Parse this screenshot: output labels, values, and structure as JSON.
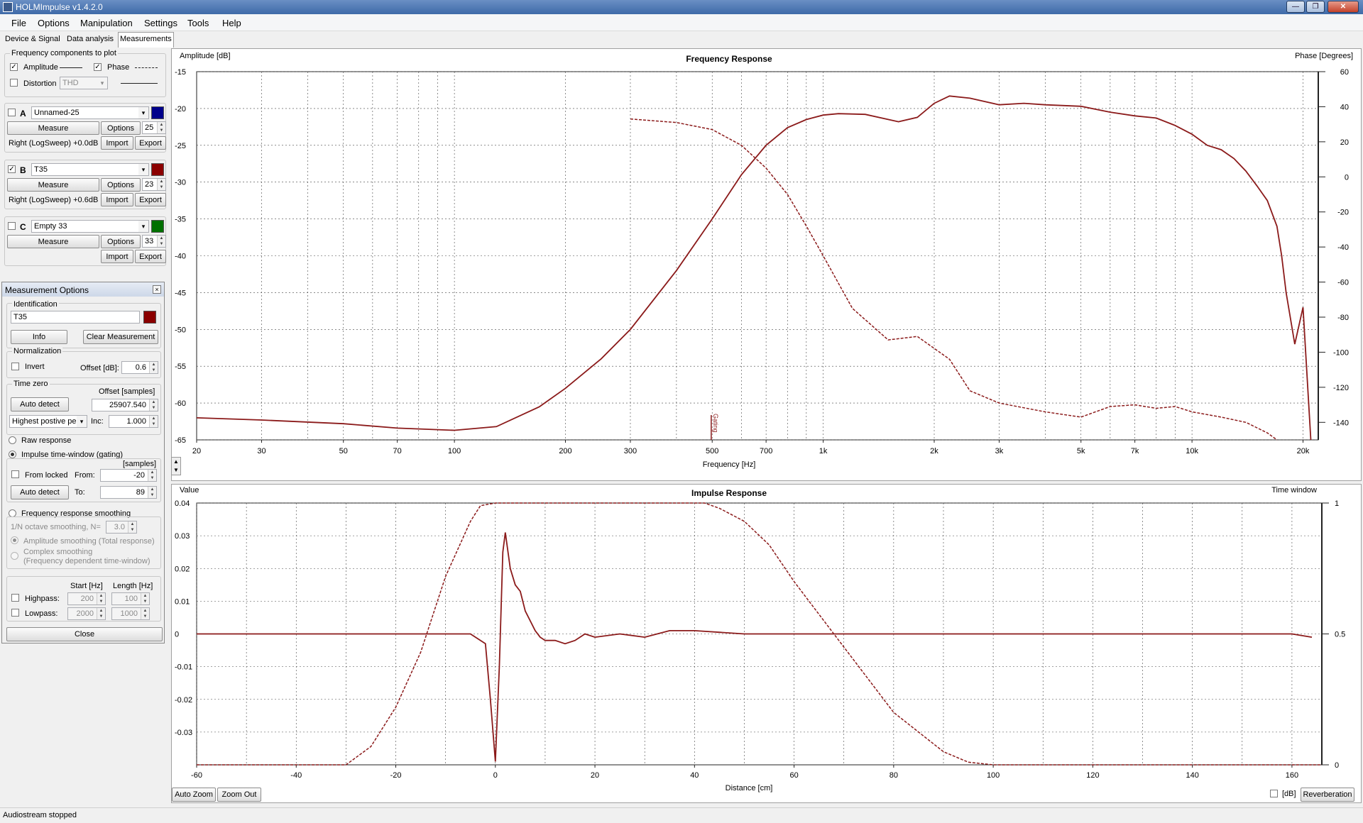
{
  "window": {
    "title": "HOLMImpulse  v1.4.2.0",
    "min": "—",
    "max": "❐",
    "close": "✕"
  },
  "menu": [
    "File",
    "Options",
    "Manipulation",
    "Settings",
    "Tools",
    "Help"
  ],
  "tabs": [
    "Device & Signal",
    "Data analysis",
    "Measurements"
  ],
  "freq_components": {
    "title": "Frequency components to plot",
    "amplitude": "Amplitude",
    "amplitude_checked": true,
    "phase": "Phase",
    "phase_checked": true,
    "distortion": "Distortion",
    "distortion_checked": false,
    "distortion_type": "THD"
  },
  "channels": [
    {
      "letter": "A",
      "checked": false,
      "name": "Unnamed-25",
      "color": "#00008b",
      "measure": "Measure",
      "options": "Options",
      "count": "25",
      "info": "Right (LogSweep) +0.0dB",
      "import": "Import",
      "export": "Export"
    },
    {
      "letter": "B",
      "checked": true,
      "name": "T35",
      "color": "#8b0000",
      "measure": "Measure",
      "options": "Options",
      "count": "23",
      "info": "Right (LogSweep) +0.6dB",
      "import": "Import",
      "export": "Export"
    },
    {
      "letter": "C",
      "checked": false,
      "name": "Empty 33",
      "color": "#007000",
      "measure": "Measure",
      "options": "Options",
      "count": "33",
      "info": "",
      "import": "Import",
      "export": "Export"
    }
  ],
  "meas_options": {
    "title": "Measurement Options",
    "identification": "Identification",
    "id_value": "T35",
    "id_color": "#8b0000",
    "info": "Info",
    "clear": "Clear Measurement",
    "normalization": "Normalization",
    "invert": "Invert",
    "offset_label": "Offset [dB]:",
    "offset_value": "0.6",
    "time_zero": "Time zero",
    "offset_samples_label": "Offset [samples]",
    "auto_detect": "Auto detect",
    "offset_samples": "25907.540",
    "peak_mode": "Highest postive pe",
    "inc_label": "Inc:",
    "inc_value": "1.000",
    "raw_response": "Raw response",
    "impulse_window": "Impulse time-window (gating)",
    "samples": "[samples]",
    "from_locked": "From locked",
    "from_label": "From:",
    "from_value": "-20",
    "to_label": "To:",
    "to_value": "89",
    "auto_detect2": "Auto detect",
    "fr_smoothing": "Frequency response smoothing",
    "octave": "1/N octave smoothing, N=",
    "octave_value": "3.0",
    "amp_smoothing": "Amplitude smoothing (Total response)",
    "complex_smoothing": "Complex smoothing",
    "complex_smoothing2": "(Frequency dependent time-window)",
    "start_hz": "Start [Hz]",
    "length_hz": "Length [Hz]",
    "highpass": "Highpass:",
    "hp_start": "200",
    "hp_length": "100",
    "lowpass": "Lowpass:",
    "lp_start": "2000",
    "lp_length": "1000",
    "close": "Close"
  },
  "freq_plot": {
    "title": "Frequency Response",
    "y_left_label": "Amplitude [dB]",
    "y_right_label": "Phase [Degrees]",
    "x_label": "Frequency [Hz]",
    "y_ticks": [
      "-15",
      "-20",
      "-25",
      "-30",
      "-35",
      "-40",
      "-45",
      "-50",
      "-55",
      "-60",
      "-65"
    ],
    "phase_ticks": [
      "60",
      "40",
      "20",
      "0",
      "-20",
      "-40",
      "-60",
      "-80",
      "-100",
      "-120",
      "-140"
    ],
    "x_ticks": [
      "20",
      "30",
      "50",
      "70",
      "100",
      "200",
      "300",
      "500",
      "700",
      "1k",
      "2k",
      "3k",
      "5k",
      "7k",
      "10k",
      "20k"
    ],
    "gating_marker": "Gating"
  },
  "impulse_plot": {
    "title": "Impulse Response",
    "y_left_label": "Value",
    "y_right_label": "Time window",
    "x_label": "Distance [cm]",
    "y_ticks": [
      "0.04",
      "0.03",
      "0.02",
      "0.01",
      "0",
      "-0.01",
      "-0.02",
      "-0.03"
    ],
    "window_ticks": [
      "1",
      "0.5",
      "0"
    ],
    "x_ticks": [
      "-60",
      "-40",
      "-20",
      "0",
      "20",
      "40",
      "60",
      "80",
      "100",
      "120",
      "140",
      "160"
    ]
  },
  "bottom_buttons": {
    "auto_zoom": "Auto Zoom",
    "zoom_out": "Zoom Out",
    "db": "[dB]",
    "reverberation": "Reverberation"
  },
  "status": "Audiostream stopped",
  "chart_data": [
    {
      "type": "line",
      "title": "Frequency Response",
      "xlabel": "Frequency [Hz]",
      "ylabel": "Amplitude [dB]",
      "y2label": "Phase [Degrees]",
      "xscale": "log",
      "xlim": [
        20,
        22000
      ],
      "ylim": [
        -65,
        -15
      ],
      "y2lim": [
        -150,
        60
      ],
      "grid": true,
      "series": [
        {
          "style": "solid",
          "axis": "left",
          "color": "#8b1a1a",
          "x": [
            20,
            30,
            50,
            70,
            100,
            130,
            170,
            200,
            250,
            300,
            400,
            500,
            600,
            700,
            800,
            900,
            1000,
            1100,
            1300,
            1600,
            1800,
            2000,
            2200,
            2500,
            3000,
            3500,
            4000,
            5000,
            6000,
            7000,
            8000,
            9000,
            10000,
            11000,
            12000,
            13000,
            14000,
            15000,
            16000,
            17000,
            17500,
            18000,
            19000,
            20000,
            21000
          ],
          "y": [
            -62,
            -62.3,
            -62.8,
            -63.4,
            -63.7,
            -63.2,
            -60.5,
            -58,
            -54,
            -50,
            -42,
            -35,
            -29,
            -25,
            -22.6,
            -21.5,
            -20.9,
            -20.7,
            -20.8,
            -21.8,
            -21.2,
            -19.3,
            -18.3,
            -18.6,
            -19.5,
            -19.3,
            -19.5,
            -19.7,
            -20.5,
            -21,
            -21.3,
            -22.3,
            -23.5,
            -25,
            -25.6,
            -26.8,
            -28.5,
            -30.5,
            -32.5,
            -36,
            -40,
            -45,
            -52,
            -47,
            -66
          ]
        },
        {
          "style": "dashed",
          "axis": "right",
          "color": "#8b1a1a",
          "x": [
            300,
            400,
            500,
            600,
            700,
            800,
            900,
            1000,
            1200,
            1500,
            1800,
            2200,
            2500,
            3000,
            4000,
            5000,
            6000,
            7000,
            8000,
            9000,
            10000,
            12000,
            14000,
            16000,
            17000
          ],
          "y": [
            33,
            31,
            27,
            18,
            5,
            -10,
            -28,
            -45,
            -75,
            -93,
            -91,
            -104,
            -122,
            -129,
            -134,
            -137,
            -131,
            -130,
            -132,
            -131,
            -134,
            -137,
            -140,
            -146,
            -152
          ]
        }
      ]
    },
    {
      "type": "line",
      "title": "Impulse Response",
      "xlabel": "Distance [cm]",
      "ylabel": "Value",
      "y2label": "Time window",
      "xlim": [
        -60,
        166
      ],
      "ylim": [
        -0.04,
        0.04
      ],
      "y2lim": [
        0,
        1
      ],
      "grid": true,
      "series": [
        {
          "style": "solid",
          "axis": "left",
          "color": "#8b1a1a",
          "x": [
            -60,
            -5,
            -2,
            -1,
            0,
            0.8,
            1.5,
            2,
            3,
            4,
            5,
            6,
            7,
            8,
            9,
            10,
            12,
            14,
            16,
            18,
            20,
            25,
            30,
            35,
            40,
            45,
            50,
            60,
            80,
            100,
            120,
            140,
            160,
            164
          ],
          "y": [
            0,
            0,
            -0.003,
            -0.02,
            -0.039,
            -0.01,
            0.025,
            0.031,
            0.02,
            0.015,
            0.013,
            0.007,
            0.004,
            0.001,
            -0.001,
            -0.002,
            -0.002,
            -0.003,
            -0.002,
            0,
            -0.001,
            0,
            -0.001,
            0.001,
            0.001,
            0.0005,
            0,
            0,
            0,
            0,
            0,
            0,
            0,
            -0.001
          ]
        },
        {
          "style": "dashed",
          "axis": "right",
          "color": "#8b1a1a",
          "x": [
            -60,
            -30,
            -25,
            -20,
            -15,
            -10,
            -5,
            -3,
            0,
            20,
            42,
            45,
            50,
            55,
            60,
            70,
            80,
            90,
            95,
            100,
            166
          ],
          "y": [
            0,
            0,
            0.07,
            0.22,
            0.43,
            0.72,
            0.93,
            0.99,
            1,
            1,
            1,
            0.98,
            0.93,
            0.84,
            0.7,
            0.45,
            0.2,
            0.05,
            0.01,
            0,
            0
          ]
        }
      ]
    }
  ]
}
